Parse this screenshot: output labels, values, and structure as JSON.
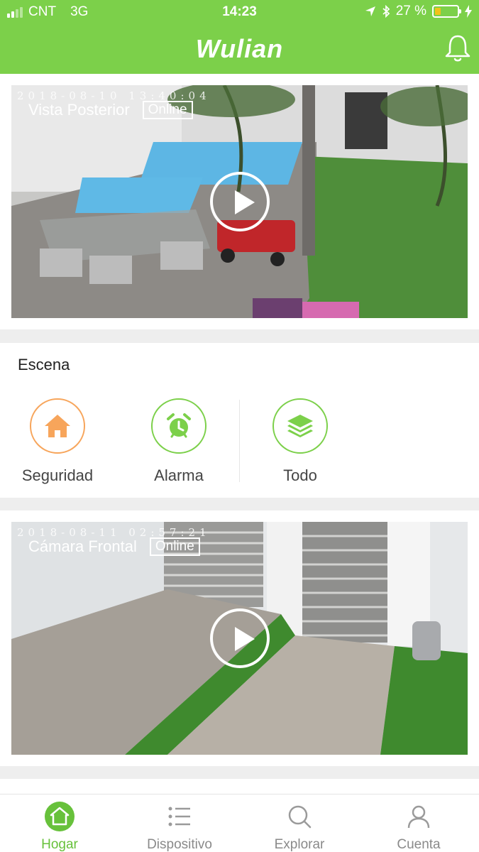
{
  "status_bar": {
    "carrier": "CNT",
    "network": "3G",
    "time": "14:23",
    "battery": "27 %",
    "battery_level": 0.27
  },
  "header": {
    "brand": "Wulian"
  },
  "cameras": [
    {
      "timestamp": "2018-08-10 13:40:04",
      "name": "Vista Posterior",
      "status": "Online"
    },
    {
      "timestamp": "2018-08-11 02:57:21",
      "name": "Cámara Frontal",
      "status": "Online"
    }
  ],
  "scene": {
    "title": "Escena",
    "items": [
      {
        "label": "Seguridad",
        "icon": "home-icon",
        "color": "#f7a55b"
      },
      {
        "label": "Alarma",
        "icon": "alarm-clock-icon",
        "color": "#7cd04a"
      },
      {
        "label": "Todo",
        "icon": "layers-icon",
        "color": "#7cd04a"
      }
    ]
  },
  "tabbar": {
    "tabs": [
      {
        "label": "Hogar",
        "icon": "home-icon",
        "active": true
      },
      {
        "label": "Dispositivo",
        "icon": "list-icon",
        "active": false
      },
      {
        "label": "Explorar",
        "icon": "search-icon",
        "active": false
      },
      {
        "label": "Cuenta",
        "icon": "person-icon",
        "active": false
      }
    ]
  },
  "colors": {
    "accent": "#7cd04a",
    "orange": "#f7a55b"
  }
}
